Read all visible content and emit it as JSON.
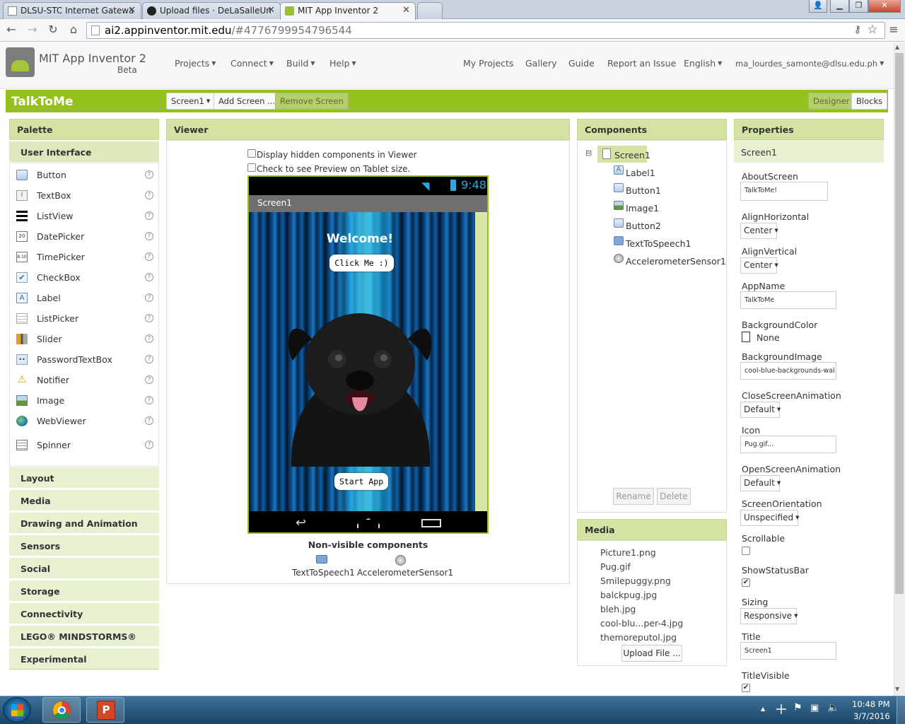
{
  "browser": {
    "tabs": [
      {
        "title": "DLSU-STC Internet Gatewa"
      },
      {
        "title": "Upload files · DeLaSalleUn"
      },
      {
        "title": "MIT App Inventor 2"
      }
    ],
    "url_host": "ai2.appinventor.mit.edu",
    "url_rest": "/#4776799954796544"
  },
  "app_header": {
    "name": "MIT App Inventor 2",
    "badge": "Beta",
    "menus": [
      "Projects",
      "Connect",
      "Build",
      "Help"
    ],
    "links": [
      "My Projects",
      "Gallery",
      "Guide",
      "Report an Issue"
    ],
    "language": "English",
    "account": "ma_lourdes_samonte@dlsu.edu.ph"
  },
  "project_bar": {
    "project_name": "TalkToMe",
    "screen_select": "Screen1",
    "add_screen": "Add Screen ...",
    "remove_screen": "Remove Screen",
    "designer": "Designer",
    "blocks": "Blocks"
  },
  "palette": {
    "title": "Palette",
    "active_category": "User Interface",
    "items": [
      {
        "label": "Button",
        "icon": "button-icon"
      },
      {
        "label": "TextBox",
        "icon": "textbox-icon"
      },
      {
        "label": "ListView",
        "icon": "listview-icon"
      },
      {
        "label": "DatePicker",
        "icon": "datepicker-icon"
      },
      {
        "label": "TimePicker",
        "icon": "timepicker-icon"
      },
      {
        "label": "CheckBox",
        "icon": "checkbox-icon"
      },
      {
        "label": "Label",
        "icon": "label-icon"
      },
      {
        "label": "ListPicker",
        "icon": "listpicker-icon"
      },
      {
        "label": "Slider",
        "icon": "slider-icon"
      },
      {
        "label": "PasswordTextBox",
        "icon": "password-icon"
      },
      {
        "label": "Notifier",
        "icon": "warning-icon"
      },
      {
        "label": "Image",
        "icon": "image-icon"
      },
      {
        "label": "WebViewer",
        "icon": "globe-icon"
      },
      {
        "label": "Spinner",
        "icon": "spinner-icon"
      }
    ],
    "help_glyph": "?",
    "categories": [
      "Layout",
      "Media",
      "Drawing and Animation",
      "Sensors",
      "Social",
      "Storage",
      "Connectivity",
      "LEGO® MINDSTORMS®",
      "Experimental"
    ]
  },
  "viewer": {
    "title": "Viewer",
    "option_hidden": "Display hidden components in Viewer",
    "option_tablet": "Check to see Preview on Tablet size.",
    "phone": {
      "time": "9:48",
      "screen_title": "Screen1",
      "welcome": "Welcome!",
      "button1": "Click Me :)",
      "button2": "Start App"
    },
    "nonvisible_title": "Non-visible components",
    "nonvisible": [
      "TextToSpeech1",
      "AccelerometerSensor1"
    ]
  },
  "components": {
    "title": "Components",
    "collapse_glyph": "⊟",
    "root": "Screen1",
    "children": [
      "Label1",
      "Button1",
      "Image1",
      "Button2",
      "TextToSpeech1",
      "AccelerometerSensor1"
    ],
    "rename": "Rename",
    "delete": "Delete"
  },
  "media": {
    "title": "Media",
    "files": [
      "Picture1.png",
      "Pug.gif",
      "Smilepuggy.png",
      "balckpug.jpg",
      "bleh.jpg",
      "cool-blu...per-4.jpg",
      "themoreputol.jpg"
    ],
    "upload": "Upload File ..."
  },
  "properties": {
    "title": "Properties",
    "component": "Screen1",
    "about_screen_label": "AboutScreen",
    "about_screen_value": "TalkToMe!",
    "align_h_label": "AlignHorizontal",
    "align_h_value": "Center",
    "align_v_label": "AlignVertical",
    "align_v_value": "Center",
    "app_name_label": "AppName",
    "app_name_value": "TalkToMe",
    "bg_color_label": "BackgroundColor",
    "bg_color_value": "None",
    "bg_image_label": "BackgroundImage",
    "bg_image_value": "cool-blue-backgrounds-wal",
    "close_anim_label": "CloseScreenAnimation",
    "close_anim_value": "Default",
    "icon_label": "Icon",
    "icon_value": "Pug.gif...",
    "open_anim_label": "OpenScreenAnimation",
    "open_anim_value": "Default",
    "orientation_label": "ScreenOrientation",
    "orientation_value": "Unspecified",
    "scrollable_label": "Scrollable",
    "scrollable_checked": false,
    "show_status_label": "ShowStatusBar",
    "show_status_checked": true,
    "sizing_label": "Sizing",
    "sizing_value": "Responsive",
    "title_label": "Title",
    "title_value": "Screen1",
    "title_visible_label": "TitleVisible",
    "title_visible_checked": true,
    "check_glyph": "✔"
  },
  "taskbar": {
    "time": "10:48 PM",
    "date": "3/7/2016"
  },
  "colors": {
    "brand_green": "#95c11f",
    "panel_header": "#d2e3a4",
    "taskbar": "#1c4566"
  }
}
